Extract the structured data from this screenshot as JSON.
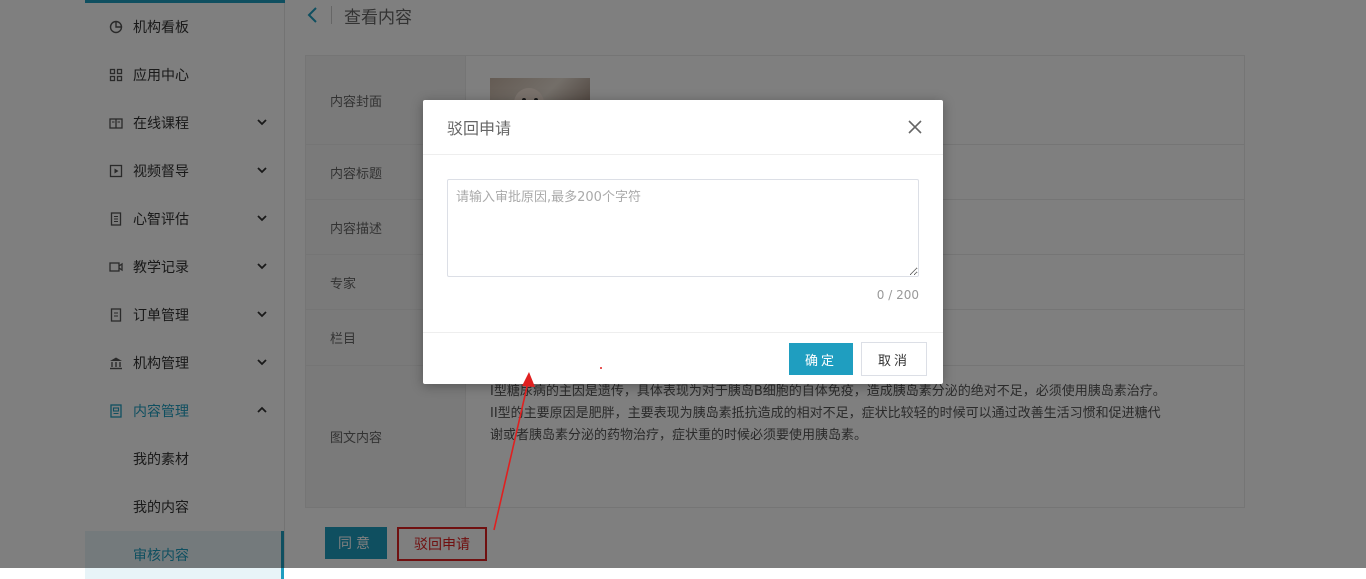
{
  "sidebar": {
    "items": [
      {
        "label": "机构看板",
        "icon": "pie-chart-icon"
      },
      {
        "label": "应用中心",
        "icon": "grid-icon"
      },
      {
        "label": "在线课程",
        "icon": "book-icon"
      },
      {
        "label": "视频督导",
        "icon": "play-icon"
      },
      {
        "label": "心智评估",
        "icon": "document-icon"
      },
      {
        "label": "教学记录",
        "icon": "video-camera-icon"
      },
      {
        "label": "订单管理",
        "icon": "receipt-icon"
      },
      {
        "label": "机构管理",
        "icon": "bank-icon"
      },
      {
        "label": "内容管理",
        "icon": "content-icon"
      }
    ],
    "subitems": [
      {
        "label": "我的素材"
      },
      {
        "label": "我的内容"
      },
      {
        "label": "审核内容"
      }
    ]
  },
  "header": {
    "title": "查看内容"
  },
  "detail": {
    "rows": [
      {
        "label": "内容封面"
      },
      {
        "label": "内容标题"
      },
      {
        "label": "内容描述"
      },
      {
        "label": "专家"
      },
      {
        "label": "栏目"
      },
      {
        "label": "图文内容"
      }
    ],
    "content_lines": [
      "I型糖尿病的主因是遗传，具体表现为对于胰岛B细胞的自体免疫，造成胰岛素分泌的绝对不足，必须使用胰岛素治疗。",
      "II型的主要原因是肥胖，主要表现为胰岛素抵抗造成的相对不足，症状比较轻的时候可以通过改善生活习惯和促进糖代",
      "谢或者胰岛素分泌的药物治疗，症状重的时候必须要使用胰岛素。"
    ]
  },
  "actions": {
    "agree_label": "同意",
    "reject_label": "驳回申请"
  },
  "dialog": {
    "title": "驳回申请",
    "placeholder": "请输入审批原因,最多200个字符",
    "counter": "0 / 200",
    "ok_label": "确定",
    "cancel_label": "取消"
  },
  "colors": {
    "accent": "#1f9ec0",
    "annotation": "#e02020"
  }
}
